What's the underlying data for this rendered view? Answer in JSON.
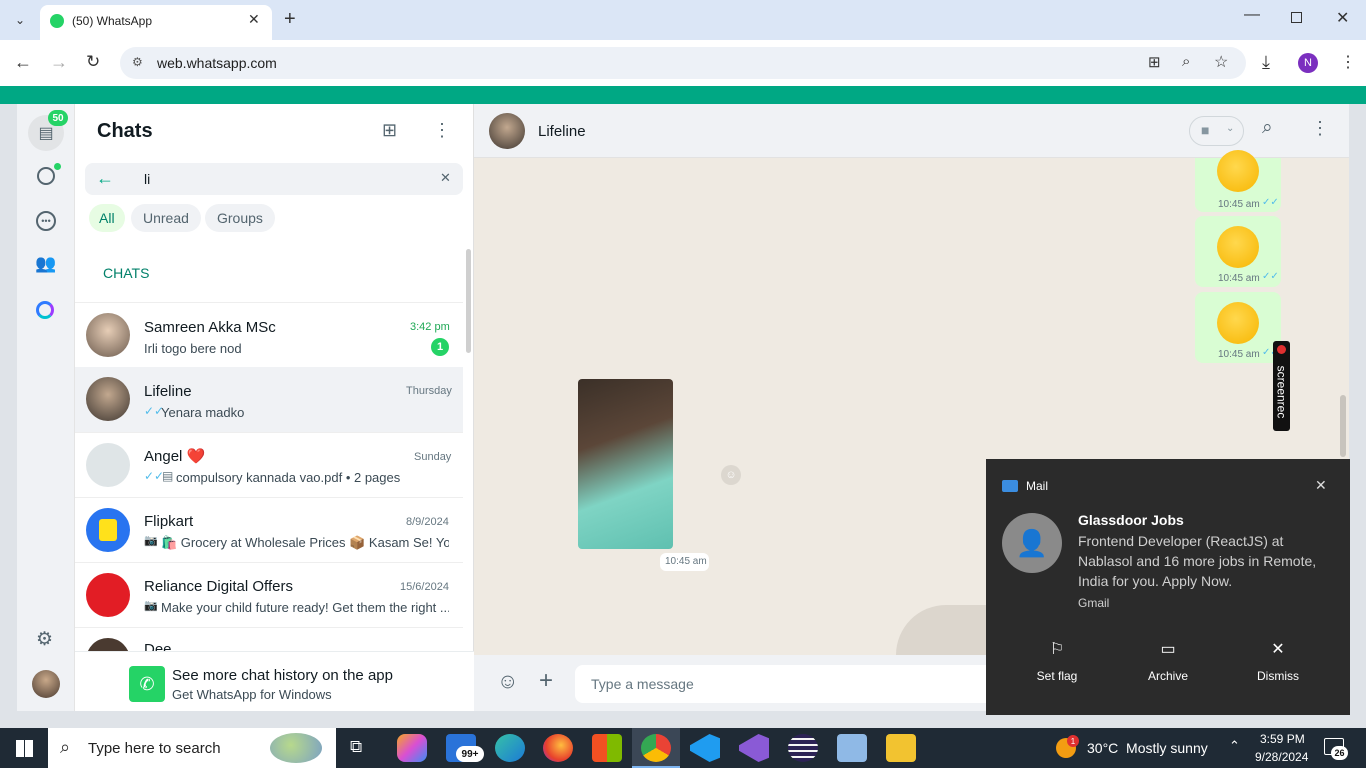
{
  "browser": {
    "tab_title": "(50) WhatsApp",
    "url": "web.whatsapp.com",
    "profile_initial": "N"
  },
  "sidebar": {
    "unread_badge": "50"
  },
  "chatlist": {
    "title": "Chats",
    "search_value": "li",
    "filters": [
      "All",
      "Unread",
      "Groups"
    ],
    "section_label": "CHATS",
    "rows": [
      {
        "name": "Samreen Akka MSc",
        "preview": "Irli togo bere nod",
        "time": "3:42 pm",
        "unread": "1"
      },
      {
        "name": "Lifeline",
        "preview": "Yenara madko",
        "time": "Thursday"
      },
      {
        "name": "Angel ❤️",
        "preview": "compulsory kannada vao.pdf • 2 pages",
        "time": "Sunday"
      },
      {
        "name": "Flipkart",
        "preview": "🛍️ Grocery at Wholesale Prices 📦 Kasam Se! Yo...",
        "time": "8/9/2024"
      },
      {
        "name": "Reliance Digital Offers",
        "preview": "Make your child future ready! Get them the right ...",
        "time": "15/6/2024"
      },
      {
        "name": "Dee",
        "preview": "",
        "time": ""
      }
    ],
    "promo_title": "See more chat history on the app",
    "promo_sub": "Get WhatsApp for Windows"
  },
  "chat": {
    "contact": "Lifeline",
    "messages": [
      {
        "time": "10:45 am"
      },
      {
        "time": "10:45 am"
      },
      {
        "time": "10:45 am"
      }
    ],
    "image_time": "10:45 am",
    "composer_placeholder": "Type a message"
  },
  "overlay": {
    "screenrec_label": "screenrec"
  },
  "mail_toast": {
    "app": "Mail",
    "sender": "Glassdoor Jobs",
    "body": "Frontend Developer (ReactJS) at Nablasol and 16 more jobs in Remote, India for you. Apply Now.",
    "account": "Gmail",
    "actions": [
      "Set flag",
      "Archive",
      "Dismiss"
    ]
  },
  "taskbar": {
    "search_placeholder": "Type here to search",
    "mail_badge": "99+",
    "weather_badge": "1",
    "weather": "30°C  Mostly sunny",
    "time": "3:59 PM",
    "date": "9/28/2024",
    "notif_count": "26"
  },
  "colors": {
    "wa_green": "#00a884",
    "bubble_out": "#d9fdd3",
    "mail_bg": "#2b2b2b"
  }
}
